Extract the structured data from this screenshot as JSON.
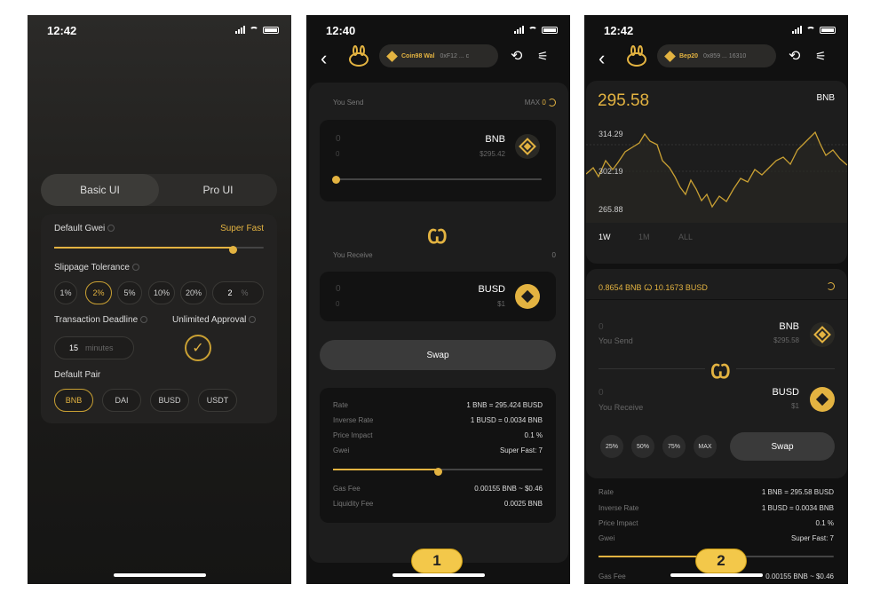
{
  "phone1": {
    "time": "12:42",
    "tabs": [
      "Basic UI",
      "Pro UI"
    ],
    "gwei_label": "Default Gwei",
    "gwei_value": "Super Fast",
    "gwei_level": 0.85,
    "slippage_label": "Slippage Tolerance",
    "slippage_options": [
      "1%",
      "2%",
      "5%",
      "10%",
      "20%"
    ],
    "slippage_custom": "2",
    "slippage_unit": "%",
    "deadline_label": "Transaction Deadline",
    "deadline_value": "15",
    "deadline_unit": "minutes",
    "approval_label": "Unlimited Approval",
    "pair_label": "Default Pair",
    "pairs": [
      "BNB",
      "DAI",
      "BUSD",
      "USDT"
    ]
  },
  "phone2": {
    "time": "12:40",
    "wallet_name": "Coin98 Wal",
    "wallet_addr": "0xF12 ... c",
    "you_send": "You Send",
    "max_label": "MAX",
    "max_value": "0",
    "send_amount": "0",
    "send_amount2": "0",
    "send_token": "BNB",
    "send_price": "$295.42",
    "you_receive": "You Receive",
    "receive_value": "0",
    "recv_amount": "0",
    "recv_amount2": "0",
    "recv_token": "BUSD",
    "recv_price": "$1",
    "swap": "Swap",
    "rows": [
      {
        "label": "Rate",
        "value": "1 BNB = 295.424 BUSD"
      },
      {
        "label": "Inverse Rate",
        "value": "1 BUSD = 0.0034 BNB"
      },
      {
        "label": "Price Impact",
        "value": "0.1 %"
      },
      {
        "label": "Gwei",
        "value": "Super Fast: 7"
      }
    ],
    "gwei_level": 0.5,
    "fee_rows": [
      {
        "label": "Gas Fee",
        "value": "0.00155 BNB ~ $0.46"
      },
      {
        "label": "Liquidity Fee",
        "value": "0.0025 BNB"
      }
    ],
    "badge": "1"
  },
  "phone3": {
    "time": "12:42",
    "wallet_name": "Bep20",
    "wallet_addr": "0x859 ... 16310",
    "price": "295.58",
    "price_token": "BNB",
    "chart_ticks": [
      "314.29",
      "302.19",
      "265.88"
    ],
    "ranges": [
      "1W",
      "1M",
      "ALL"
    ],
    "pair_rate": "0.8654 BNB",
    "pair_rate2": "10.1673 BUSD",
    "send_amount": "0",
    "send_label": "You Send",
    "send_token": "BNB",
    "send_price": "$295.58",
    "recv_amount": "0",
    "recv_label": "You Receive",
    "recv_token": "BUSD",
    "recv_price": "$1",
    "chips": [
      "25%",
      "50%",
      "75%",
      "MAX"
    ],
    "swap": "Swap",
    "rows": [
      {
        "label": "Rate",
        "value": "1 BNB = 295.58 BUSD"
      },
      {
        "label": "Inverse Rate",
        "value": "1 BUSD = 0.0034 BNB"
      },
      {
        "label": "Price Impact",
        "value": "0.1 %"
      },
      {
        "label": "Gwei",
        "value": "Super Fast: 7"
      }
    ],
    "gwei_level": 0.5,
    "fee_label": "Gas Fee",
    "fee_value": "0.00155 BNB ~ $0.46",
    "badge": "2"
  },
  "colors": {
    "accent": "#e3b341",
    "badge": "#f3c84a",
    "background": "#111111"
  }
}
